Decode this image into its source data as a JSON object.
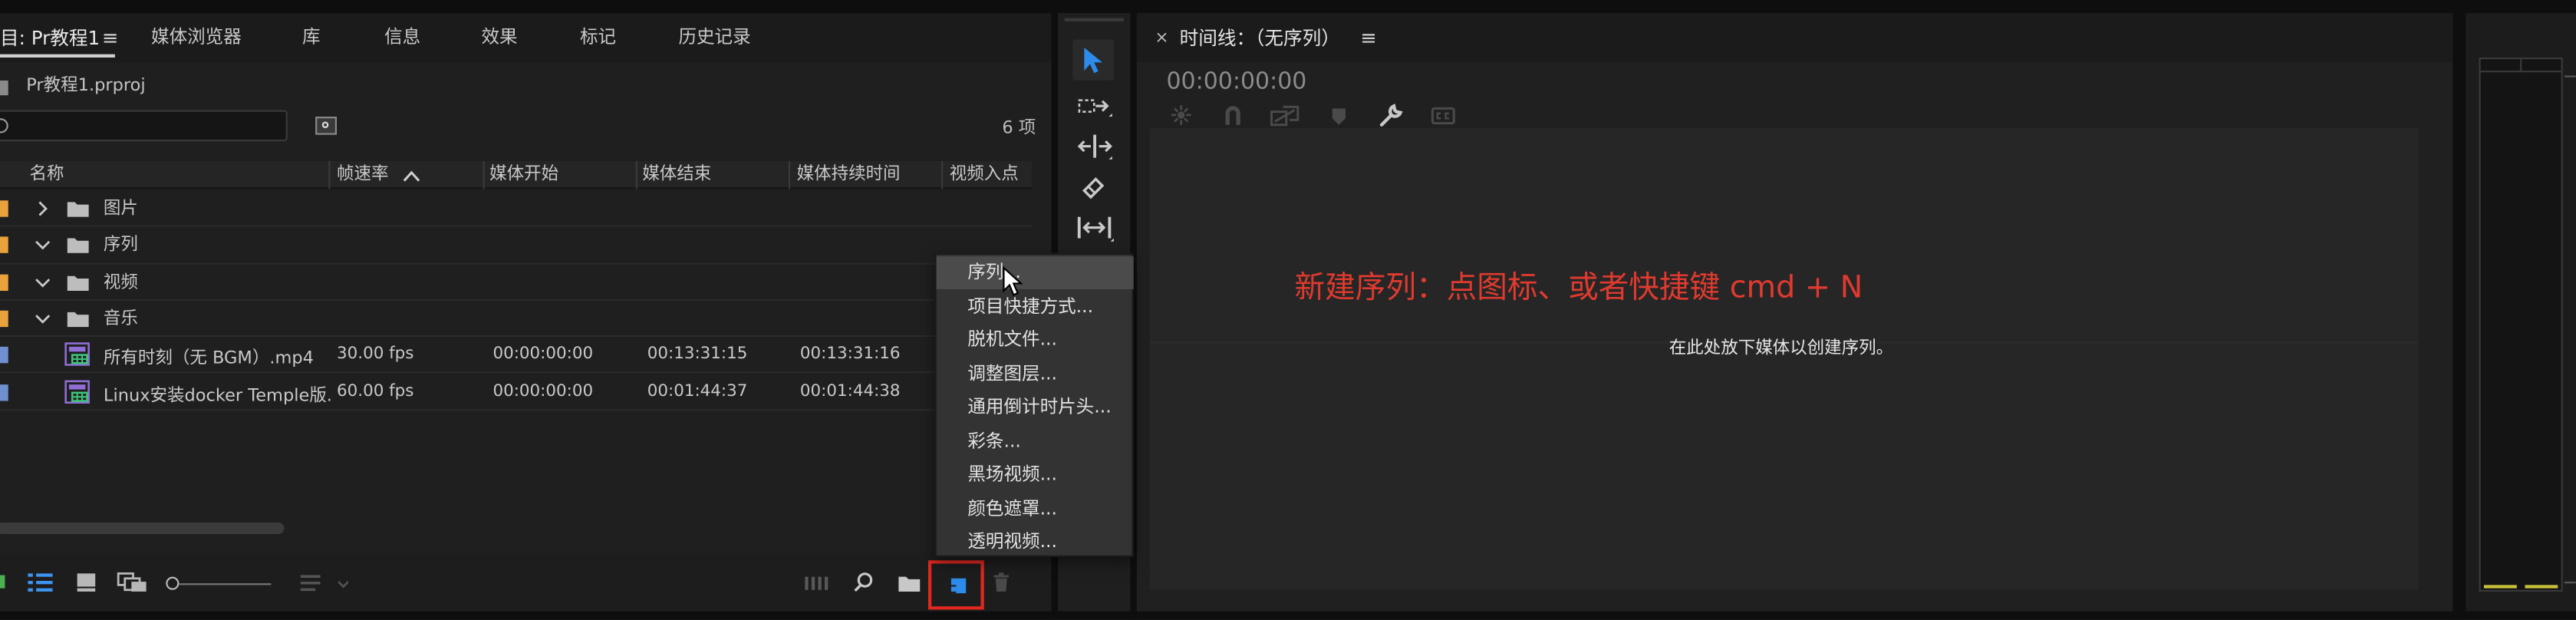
{
  "project_panel": {
    "tabs": [
      {
        "label": "目: Pr教程1"
      },
      {
        "label": "媒体浏览器"
      },
      {
        "label": "库"
      },
      {
        "label": "信息"
      },
      {
        "label": "效果"
      },
      {
        "label": "标记"
      },
      {
        "label": "历史记录"
      }
    ],
    "project_file": "Pr教程1.prproj",
    "search_value": "",
    "item_count": "6 项",
    "columns": [
      "名称",
      "帧速率",
      "媒体开始",
      "媒体结束",
      "媒体持续时间",
      "视频入点"
    ],
    "folders": [
      {
        "name": "图片",
        "expanded": false,
        "color": "#e8a33c"
      },
      {
        "name": "序列",
        "expanded": true,
        "color": "#e8a33c"
      },
      {
        "name": "视频",
        "expanded": true,
        "color": "#e8a33c"
      },
      {
        "name": "音乐",
        "expanded": true,
        "color": "#e8a33c"
      }
    ],
    "clips": [
      {
        "name": "所有时刻（无 BGM）.mp4",
        "frame_rate": "30.00 fps",
        "media_start": "00:00:00:00",
        "media_end": "00:13:31:15",
        "duration": "00:13:31:16",
        "color": "#6f8fcf"
      },
      {
        "name": "Linux安装docker Temple版.",
        "frame_rate": "60.00 fps",
        "media_start": "00:00:00:00",
        "media_end": "00:01:44:37",
        "duration": "00:01:44:38",
        "color": "#6f8fcf"
      }
    ]
  },
  "new_item_menu": {
    "items": [
      "序列...",
      "项目快捷方式...",
      "脱机文件...",
      "调整图层...",
      "通用倒计时片头...",
      "彩条...",
      "黑场视频...",
      "颜色遮罩...",
      "透明视频..."
    ],
    "highlighted_index": 0
  },
  "tools": [
    "selection-tool",
    "track-select-tool",
    "ripple-edit-tool",
    "razor-tool",
    "slip-tool"
  ],
  "timeline": {
    "title": "时间线：（无序列）",
    "timecode": "00:00:00:00",
    "drop_hint": "在此处放下媒体以创建序列。"
  },
  "annotation": {
    "text": "新建序列：点图标、或者快捷键 cmd + N",
    "color": "#e03a2f"
  },
  "colors": {
    "accent_blue": "#2d8ceb",
    "highlight_red": "#e0281f",
    "meter_yellow": "#c8c23a"
  }
}
